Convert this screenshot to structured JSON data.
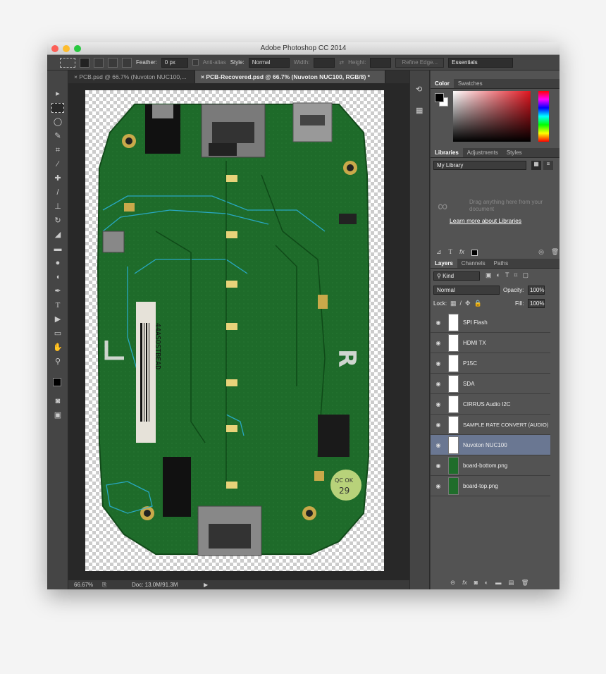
{
  "app": {
    "title": "Adobe Photoshop CC 2014"
  },
  "options": {
    "feather_label": "Feather:",
    "feather_value": "0 px",
    "antialias_label": "Anti-alias",
    "style_label": "Style:",
    "style_value": "Normal",
    "width_label": "Width:",
    "height_label": "Height:",
    "refine_edge": "Refine Edge...",
    "workspace": "Essentials"
  },
  "tabs": [
    {
      "label": "PCB.psd @ 66.7% (Nuvoton NUC100,..."
    },
    {
      "label": "PCB-Recovered.psd @ 66.7% (Nuvoton NUC100, RGB/8) *"
    }
  ],
  "status": {
    "zoom": "66.67%",
    "doc": "Doc: 13.0M/91.3M"
  },
  "color_panel": {
    "tabs": [
      "Color",
      "Swatches"
    ]
  },
  "libraries_panel": {
    "tabs": [
      "Libraries",
      "Adjustments",
      "Styles"
    ],
    "library_name": "My Library",
    "empty_text": "Drag anything here from your document",
    "learn_link": "Learn more about Libraries"
  },
  "layers_panel": {
    "tabs": [
      "Layers",
      "Channels",
      "Paths"
    ],
    "filter_label": "Kind",
    "blend_mode": "Normal",
    "opacity_label": "Opacity:",
    "opacity_value": "100%",
    "lock_label": "Lock:",
    "fill_label": "Fill:",
    "fill_value": "100%",
    "layers": [
      {
        "name": "SPI Flash"
      },
      {
        "name": "HDMI TX"
      },
      {
        "name": "P15C"
      },
      {
        "name": "SDA"
      },
      {
        "name": "CIRRUS Audio I2C"
      },
      {
        "name": "SAMPLE RATE CONVERT (AUDIO)"
      },
      {
        "name": "Nuvoton NUC100"
      },
      {
        "name": "board-bottom.png"
      },
      {
        "name": "board-top.png"
      }
    ]
  },
  "board": {
    "label_text": "44ASOSTBEAD",
    "sticker_text": "QC OK",
    "sticker_num": "29"
  },
  "colors": {
    "pcb": "#1e6b2a",
    "trace": "#2bb8e8",
    "selection": "#6a7792"
  }
}
